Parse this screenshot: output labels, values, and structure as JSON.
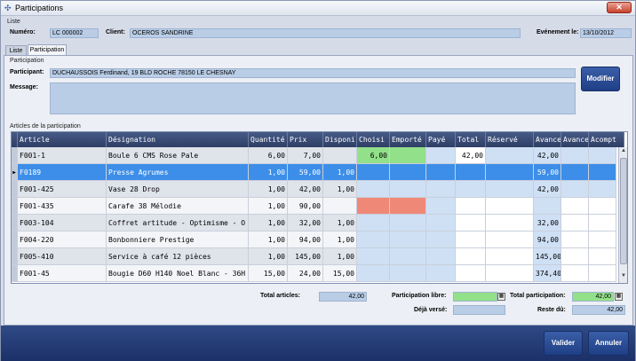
{
  "window": {
    "title": "Participations",
    "close": "✕"
  },
  "liste_section": "Liste",
  "header": {
    "numero_label": "Numéro:",
    "numero_value": "LC 000002",
    "client_label": "Client:",
    "client_value": "OCEROS SANDRINE",
    "evenement_label": "Evénement le:",
    "evenement_value": "13/10/2012"
  },
  "tabs": [
    {
      "label": "Liste"
    },
    {
      "label": "Participation"
    }
  ],
  "participation": {
    "section": "Participation",
    "participant_label": "Participant:",
    "participant_value": "DUCHAUSSOIS Ferdinand, 19 BLD ROCHE 78150 LE CHESNAY",
    "message_label": "Message:",
    "message_value": "",
    "modifier": "Modifier"
  },
  "articles_section": "Articles de la participation",
  "columns": [
    "Article",
    "Désignation",
    "Quantité",
    "Prix",
    "Disponi",
    "Choisi",
    "Emporté",
    "Payé",
    "Total",
    "Réservé",
    "Avance",
    "Avance",
    "Acompt"
  ],
  "rows": [
    {
      "article": "F001-1",
      "designation": "Boule 6 CMS Rose Pale",
      "quantite": "6,00",
      "prix": "7,00",
      "disponi": "",
      "choisi": "6,00",
      "total": "42,00",
      "avance": "42,00"
    },
    {
      "article": "F0189",
      "designation": "Presse Agrumes",
      "quantite": "1,00",
      "prix": "59,00",
      "disponi": "1,00",
      "choisi": "",
      "total": "",
      "avance": "59,00"
    },
    {
      "article": "F001-425",
      "designation": "Vase 28 Drop",
      "quantite": "1,00",
      "prix": "42,00",
      "disponi": "1,00",
      "choisi": "",
      "total": "",
      "avance": "42,00"
    },
    {
      "article": "F001-435",
      "designation": "Carafe 38 Mélodie",
      "quantite": "1,00",
      "prix": "90,00",
      "disponi": "",
      "choisi": "",
      "total": "",
      "avance": ""
    },
    {
      "article": "F003-104",
      "designation": "Coffret artitude - Optimisme - O",
      "quantite": "1,00",
      "prix": "32,00",
      "disponi": "1,00",
      "choisi": "",
      "total": "",
      "avance": "32,00"
    },
    {
      "article": "F004-220",
      "designation": "Bonbonniere Prestige",
      "quantite": "1,00",
      "prix": "94,00",
      "disponi": "1,00",
      "choisi": "",
      "total": "",
      "avance": "94,00"
    },
    {
      "article": "F005-410",
      "designation": "Service à café 12 pièces",
      "quantite": "1,00",
      "prix": "145,00",
      "disponi": "1,00",
      "choisi": "",
      "total": "",
      "avance": "145,00"
    },
    {
      "article": "F001-45",
      "designation": "Bougie D60 H140 Noel Blanc - 36H",
      "quantite": "15,00",
      "prix": "24,00",
      "disponi": "15,00",
      "choisi": "",
      "total": "",
      "avance": "374,40"
    }
  ],
  "totals": {
    "total_articles_label": "Total articles:",
    "total_articles_value": "42,00",
    "participation_libre_label": "Participation libre:",
    "participation_libre_value": "",
    "total_participation_label": "Total participation:",
    "total_participation_value": "42,00",
    "deja_verse_label": "Déjà versé:",
    "deja_verse_value": "",
    "reste_du_label": "Reste dû:",
    "reste_du_value": "42,00"
  },
  "footer": {
    "valider": "Valider",
    "annuler": "Annuler"
  },
  "colors": {
    "selected_row": "#3d8ee8",
    "green_cell": "#93e08a",
    "red_cell": "#f08878",
    "blue_cell": "#cfe0f5"
  }
}
